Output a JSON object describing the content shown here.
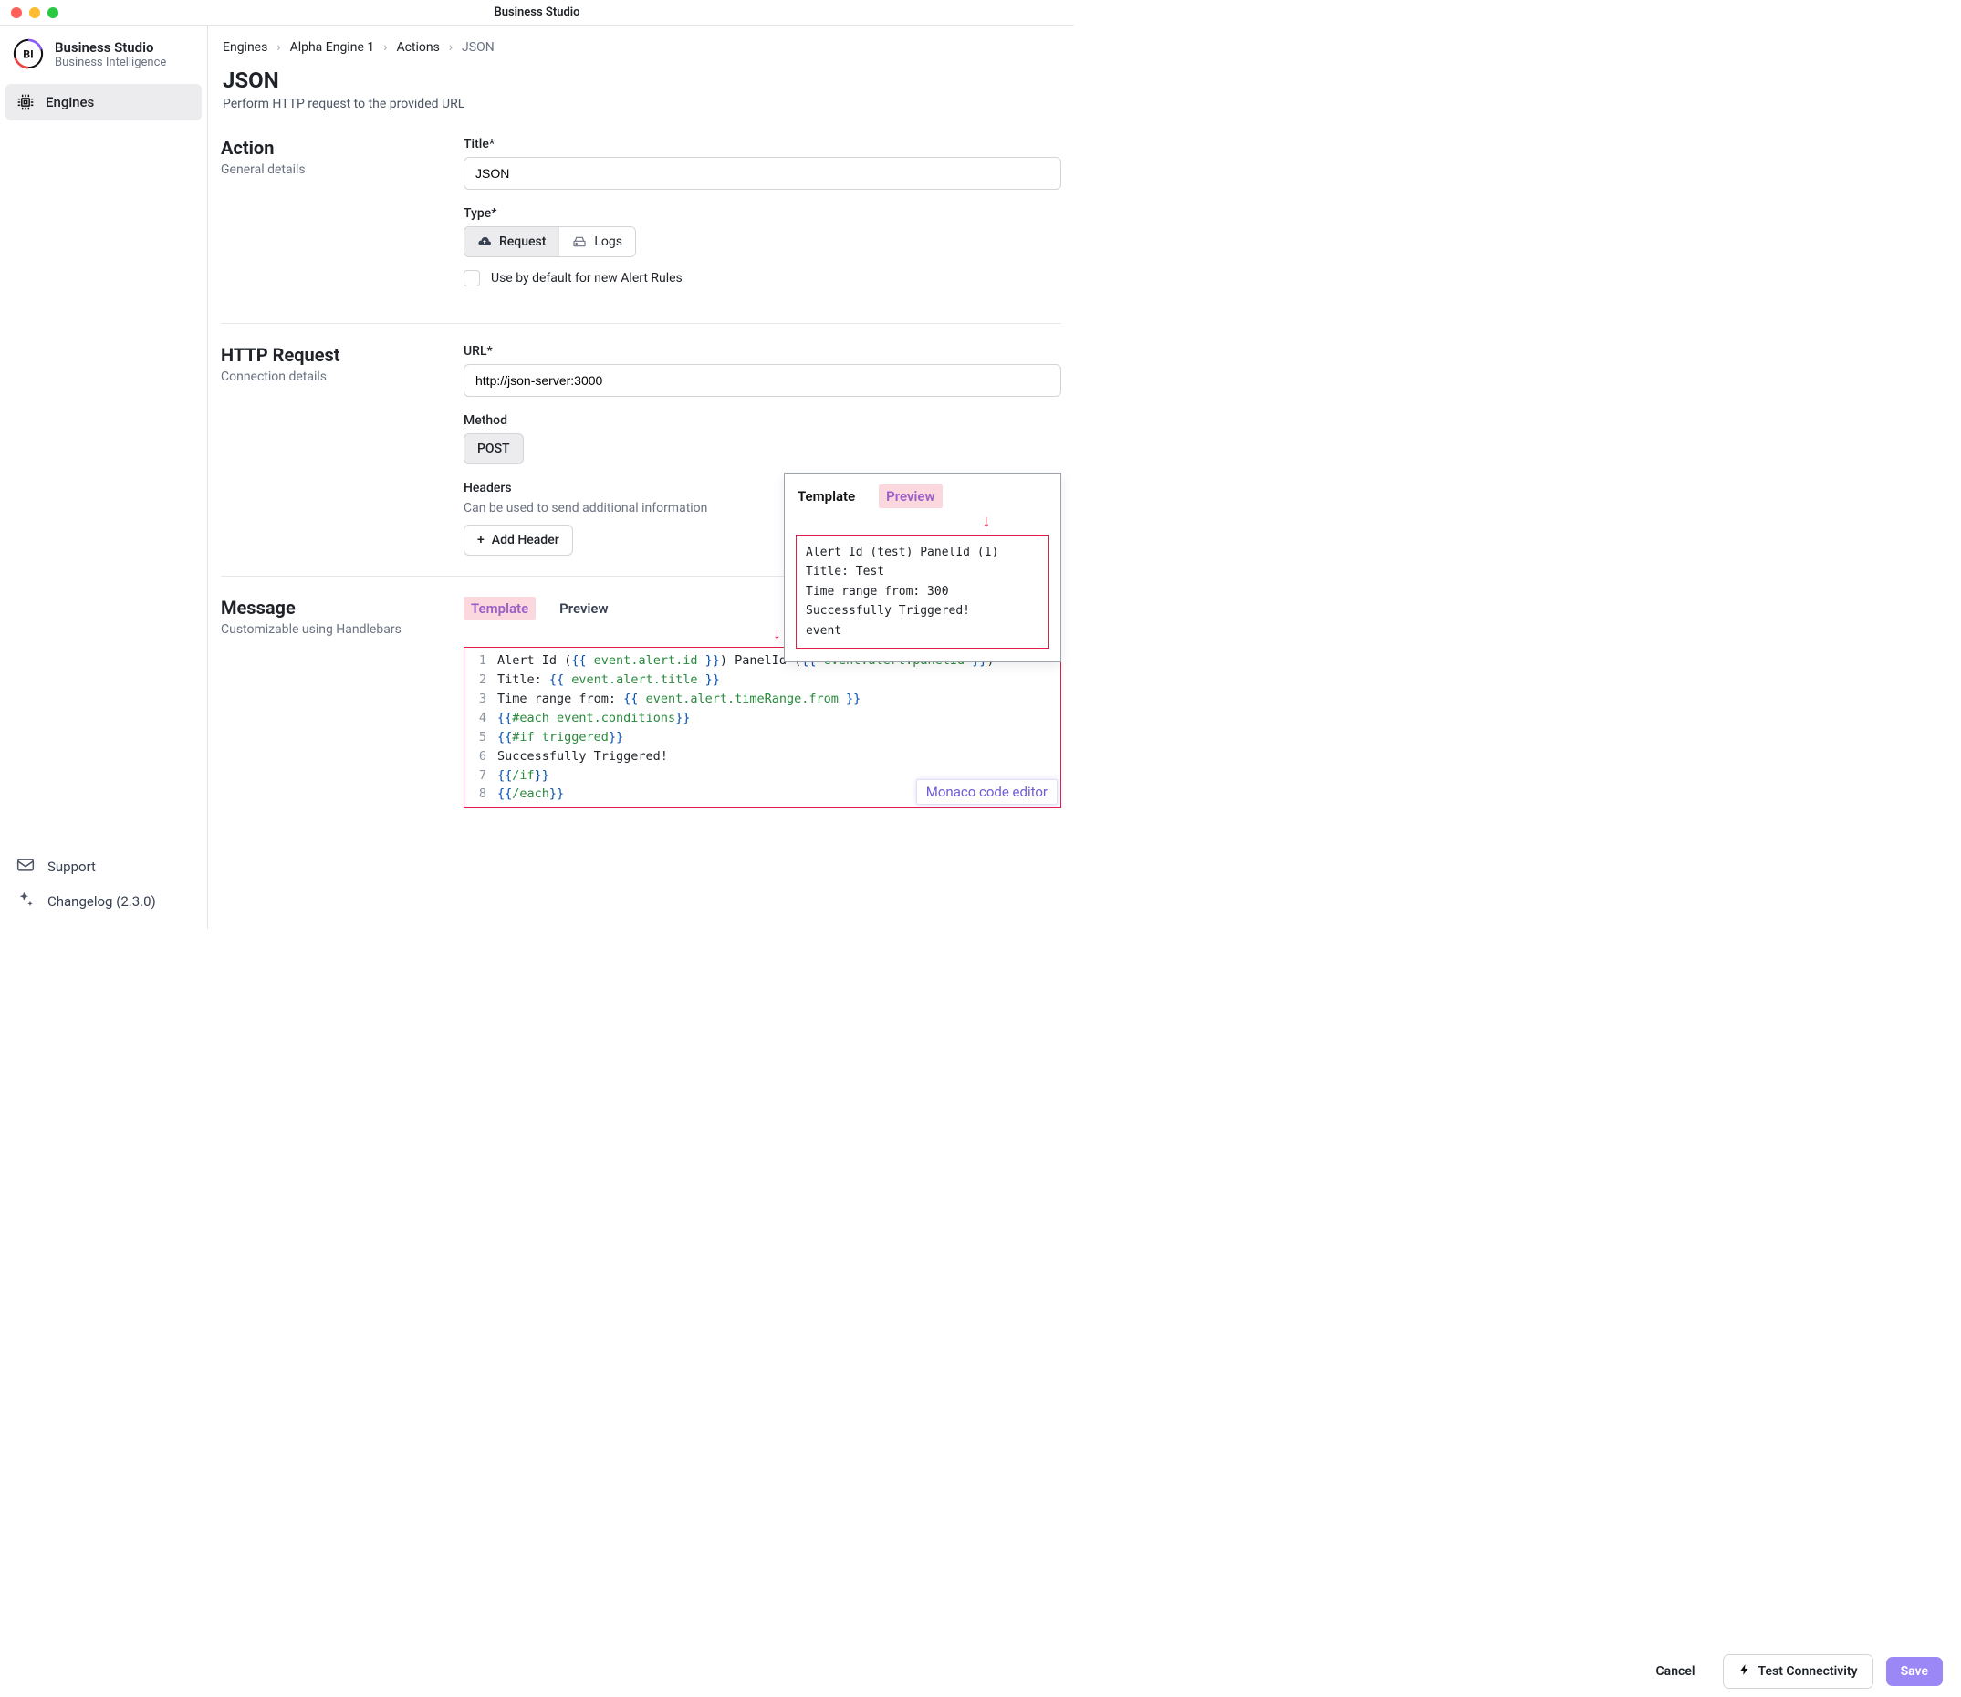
{
  "window": {
    "title": "Business Studio"
  },
  "brand": {
    "name": "Business Studio",
    "subtitle": "Business Intelligence",
    "logo_text": "BI"
  },
  "sidebar": {
    "items": [
      {
        "label": "Engines",
        "active": true
      }
    ],
    "footer": {
      "support": "Support",
      "changelog": "Changelog (2.3.0)"
    }
  },
  "breadcrumb": [
    {
      "label": "Engines",
      "link": true
    },
    {
      "label": "Alpha Engine 1",
      "link": true
    },
    {
      "label": "Actions",
      "link": true
    },
    {
      "label": "JSON",
      "link": false
    }
  ],
  "page": {
    "title": "JSON",
    "subtitle": "Perform HTTP request to the provided URL"
  },
  "action_section": {
    "title": "Action",
    "subtitle": "General details",
    "title_label": "Title*",
    "title_value": "JSON",
    "type_label": "Type*",
    "type_options": {
      "request": "Request",
      "logs": "Logs",
      "selected": "request"
    },
    "default_checkbox_label": "Use by default for new Alert Rules",
    "default_checked": false
  },
  "http_section": {
    "title": "HTTP Request",
    "subtitle": "Connection details",
    "url_label": "URL*",
    "url_value": "http://json-server:3000",
    "method_label": "Method",
    "method_value": "POST",
    "headers_label": "Headers",
    "headers_hint": "Can be used to send additional information",
    "add_header_label": "Add Header"
  },
  "message_section": {
    "title": "Message",
    "subtitle": "Customizable using Handlebars",
    "tabs": {
      "template": "Template",
      "preview": "Preview",
      "active": "template"
    },
    "code_lines": [
      {
        "n": 1,
        "parts": [
          {
            "t": "Alert Id ("
          },
          {
            "t": "{{",
            "c": "b"
          },
          {
            "t": " event.alert.id ",
            "c": "v"
          },
          {
            "t": "}}",
            "c": "b"
          },
          {
            "t": ") PanelId ("
          },
          {
            "t": "{{",
            "c": "b"
          },
          {
            "t": " event.alert.panelId ",
            "c": "v"
          },
          {
            "t": "}}",
            "c": "b"
          },
          {
            "t": ")"
          }
        ]
      },
      {
        "n": 2,
        "parts": [
          {
            "t": "Title: "
          },
          {
            "t": "{{",
            "c": "b"
          },
          {
            "t": " event.alert.title ",
            "c": "v"
          },
          {
            "t": "}}",
            "c": "b"
          }
        ]
      },
      {
        "n": 3,
        "parts": [
          {
            "t": "Time range from: "
          },
          {
            "t": "{{",
            "c": "b"
          },
          {
            "t": " event.alert.timeRange.from ",
            "c": "v"
          },
          {
            "t": "}}",
            "c": "b"
          }
        ]
      },
      {
        "n": 4,
        "parts": [
          {
            "t": "{{",
            "c": "b"
          },
          {
            "t": "#each event.conditions",
            "c": "v"
          },
          {
            "t": "}}",
            "c": "b"
          }
        ]
      },
      {
        "n": 5,
        "parts": [
          {
            "t": "{{",
            "c": "b"
          },
          {
            "t": "#if triggered",
            "c": "v"
          },
          {
            "t": "}}",
            "c": "b"
          }
        ]
      },
      {
        "n": 6,
        "parts": [
          {
            "t": "Successfully Triggered!"
          }
        ]
      },
      {
        "n": 7,
        "parts": [
          {
            "t": "{{",
            "c": "b"
          },
          {
            "t": "/if",
            "c": "v"
          },
          {
            "t": "}}",
            "c": "b"
          }
        ]
      },
      {
        "n": 8,
        "parts": [
          {
            "t": "{{",
            "c": "b"
          },
          {
            "t": "/each",
            "c": "v"
          },
          {
            "t": "}}",
            "c": "b"
          }
        ]
      }
    ],
    "monaco_badge": "Monaco code editor"
  },
  "preview_overlay": {
    "tabs": {
      "template": "Template",
      "preview": "Preview",
      "active": "preview"
    },
    "lines": [
      "Alert Id (test) PanelId (1)",
      "Title: Test",
      "Time range from: 300",
      "Successfully Triggered!",
      "event"
    ]
  },
  "footer": {
    "cancel": "Cancel",
    "test": "Test Connectivity",
    "save": "Save"
  }
}
